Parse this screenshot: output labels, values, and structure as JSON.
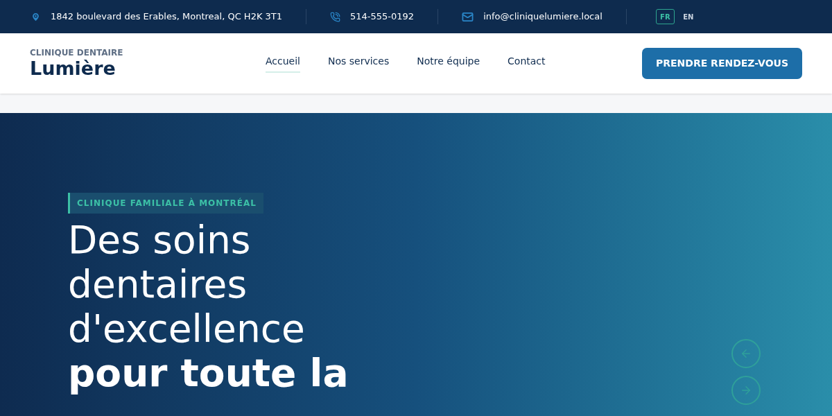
{
  "top_bar": {
    "address": "1842 boulevard des Erables, Montreal, QC H2K 3T1",
    "phone": "514-555-0192",
    "email": "info@cliniquelumiere.local",
    "languages": [
      {
        "label": "FR",
        "selected": true
      },
      {
        "label": "EN",
        "selected": false
      }
    ]
  },
  "header": {
    "logo_small": "CLINIQUE DENTAIRE",
    "logo_name": "Lumière",
    "nav": [
      {
        "label": "Accueil",
        "selected": true
      },
      {
        "label": "Nos services",
        "selected": false
      },
      {
        "label": "Notre équipe",
        "selected": false
      },
      {
        "label": "Contact",
        "selected": false
      }
    ],
    "cta": "PRENDRE RENDEZ-VOUS"
  },
  "hero": {
    "tag": "CLINIQUE FAMILIALE À MONTRÉAL",
    "heading": "Des soins dentaires d'excellence **pour toute la**"
  }
}
